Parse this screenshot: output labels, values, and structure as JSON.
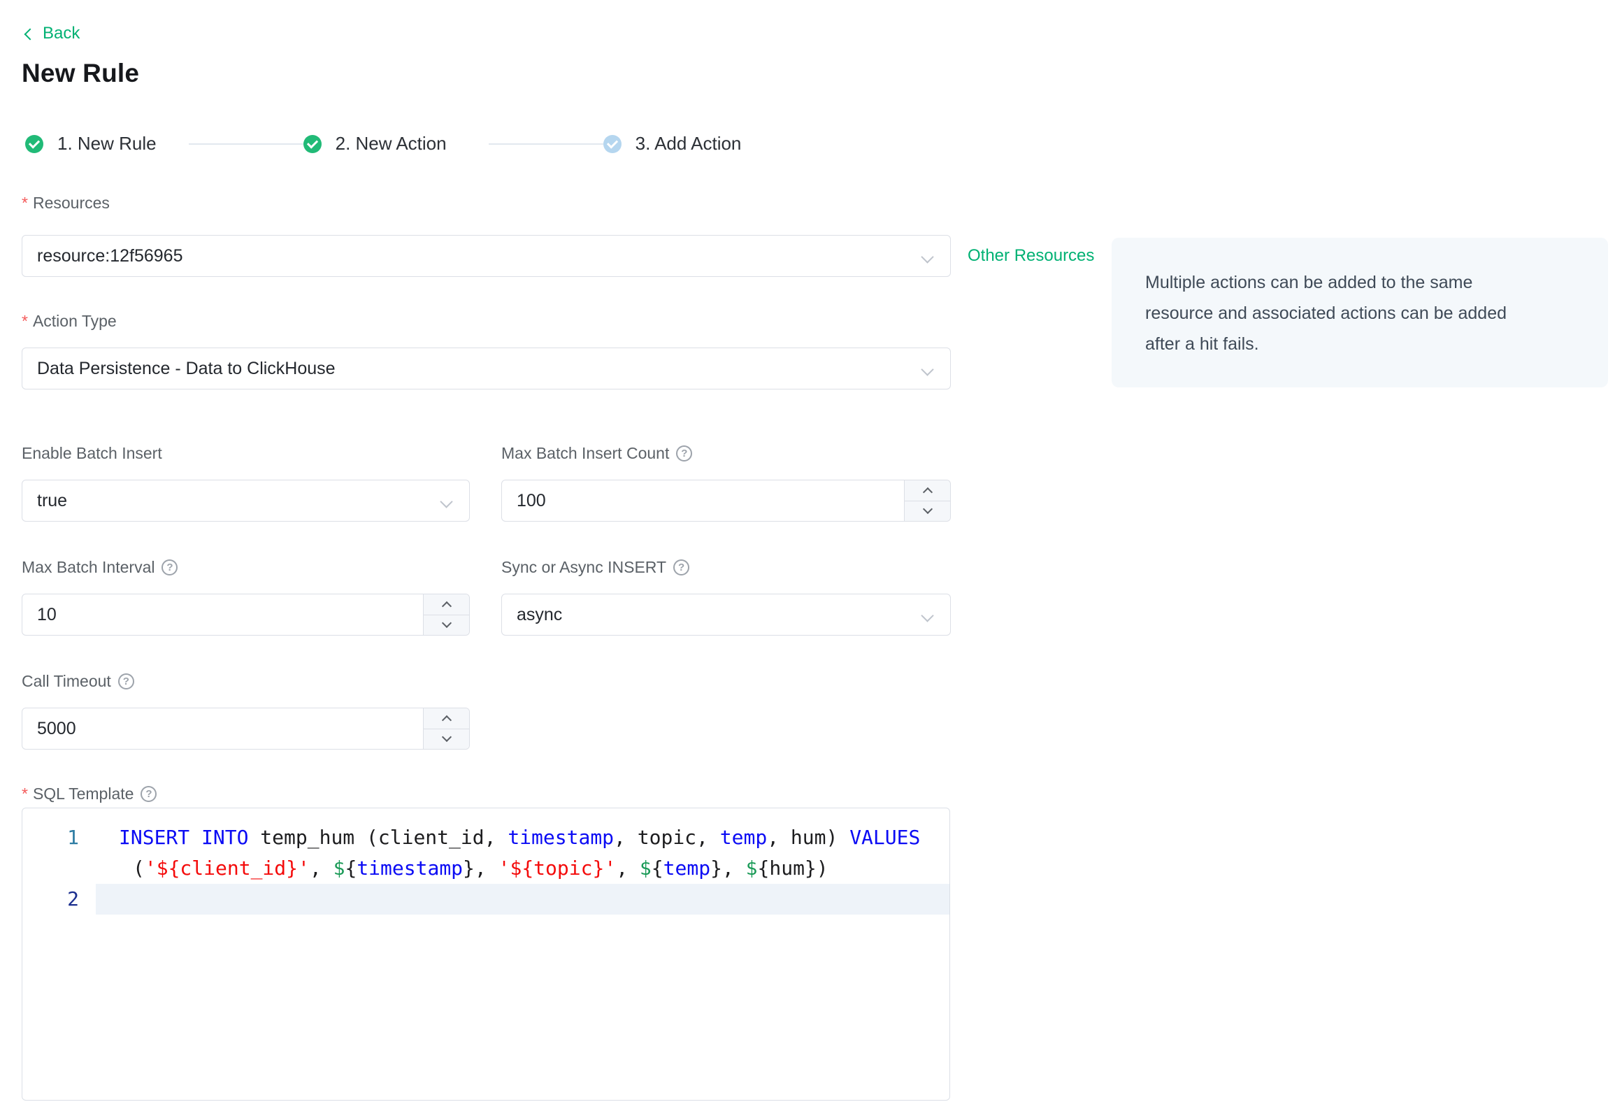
{
  "page": {
    "back_label": "Back",
    "title": "New Rule",
    "help_glyph": "?"
  },
  "colors": {
    "accent_green": "#00b173",
    "step_done_green": "#21ba77",
    "step_pending_blue": "#b5d6ef",
    "required_red": "#f45a5a",
    "info_box_bg": "#f4f8fb",
    "code_keyword": "#0b0bf4",
    "code_string": "#f40b0b",
    "code_dollar": "#1a9a57",
    "active_line_bg": "#eef3f9"
  },
  "steps": [
    {
      "label": "1. New Rule",
      "state": "done"
    },
    {
      "label": "2. New Action",
      "state": "done"
    },
    {
      "label": "3. Add Action",
      "state": "pending"
    }
  ],
  "fields": {
    "resources": {
      "label": "Resources",
      "required": "*",
      "value": "resource:12f56965",
      "side_link": "Other Resources"
    },
    "action_type": {
      "label": "Action Type",
      "required": "*",
      "value": "Data Persistence - Data to ClickHouse"
    },
    "enable_batch": {
      "label": "Enable Batch Insert",
      "value": "true"
    },
    "max_batch_count": {
      "label": "Max Batch Insert Count",
      "value": "100"
    },
    "max_batch_interval": {
      "label": "Max Batch Interval",
      "value": "10"
    },
    "sync_async": {
      "label": "Sync or Async INSERT",
      "value": "async"
    },
    "call_timeout": {
      "label": "Call Timeout",
      "value": "5000"
    },
    "sql_template": {
      "label": "SQL Template",
      "required": "*"
    }
  },
  "info_box": {
    "text": "Multiple actions can be added to the same resource and associated actions can be added after a hit fails."
  },
  "editor": {
    "lines": [
      {
        "num": "1",
        "active": false,
        "wrap": false,
        "segments": [
          {
            "c": "kw",
            "t": "INSERT INTO"
          },
          {
            "c": "plain",
            "t": " temp_hum (client_id, "
          },
          {
            "c": "kw",
            "t": "timestamp"
          },
          {
            "c": "plain",
            "t": ", topic, "
          },
          {
            "c": "kw",
            "t": "temp"
          },
          {
            "c": "plain",
            "t": ", hum) "
          },
          {
            "c": "kw",
            "t": "VALUES"
          }
        ]
      },
      {
        "num": "",
        "active": false,
        "wrap": true,
        "segments": [
          {
            "c": "plain",
            "t": "("
          },
          {
            "c": "str",
            "t": "'${client_id}'"
          },
          {
            "c": "plain",
            "t": ", "
          },
          {
            "c": "dollar",
            "t": "$"
          },
          {
            "c": "plain",
            "t": "{"
          },
          {
            "c": "kw",
            "t": "timestamp"
          },
          {
            "c": "plain",
            "t": "}, "
          },
          {
            "c": "str",
            "t": "'${topic}'"
          },
          {
            "c": "plain",
            "t": ", "
          },
          {
            "c": "dollar",
            "t": "$"
          },
          {
            "c": "plain",
            "t": "{"
          },
          {
            "c": "kw",
            "t": "temp"
          },
          {
            "c": "plain",
            "t": "}, "
          },
          {
            "c": "dollar",
            "t": "$"
          },
          {
            "c": "plain",
            "t": "{hum})"
          }
        ]
      },
      {
        "num": "2",
        "active": true,
        "wrap": false,
        "segments": []
      }
    ]
  }
}
